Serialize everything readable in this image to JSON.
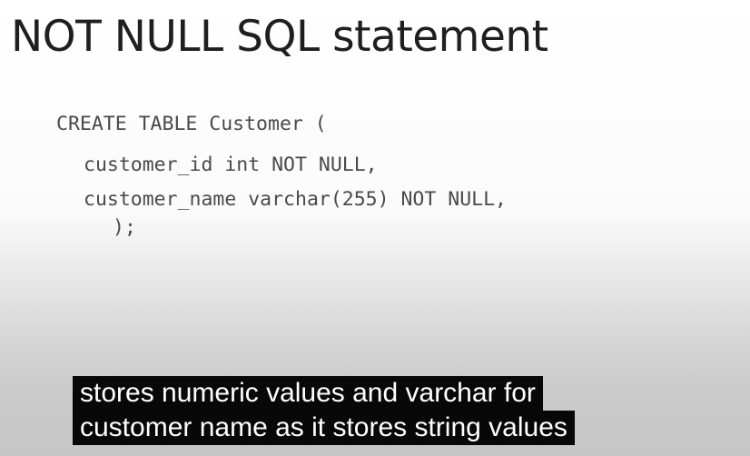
{
  "slide": {
    "title": "NOT NULL SQL statement",
    "code_lines": [
      "CREATE TABLE Customer (",
      "customer_id int NOT NULL,",
      "customer_name varchar(255) NOT NULL,",
      ");"
    ]
  },
  "captions": {
    "lines": [
      "stores numeric values and varchar for",
      "customer name as it stores string values"
    ]
  }
}
